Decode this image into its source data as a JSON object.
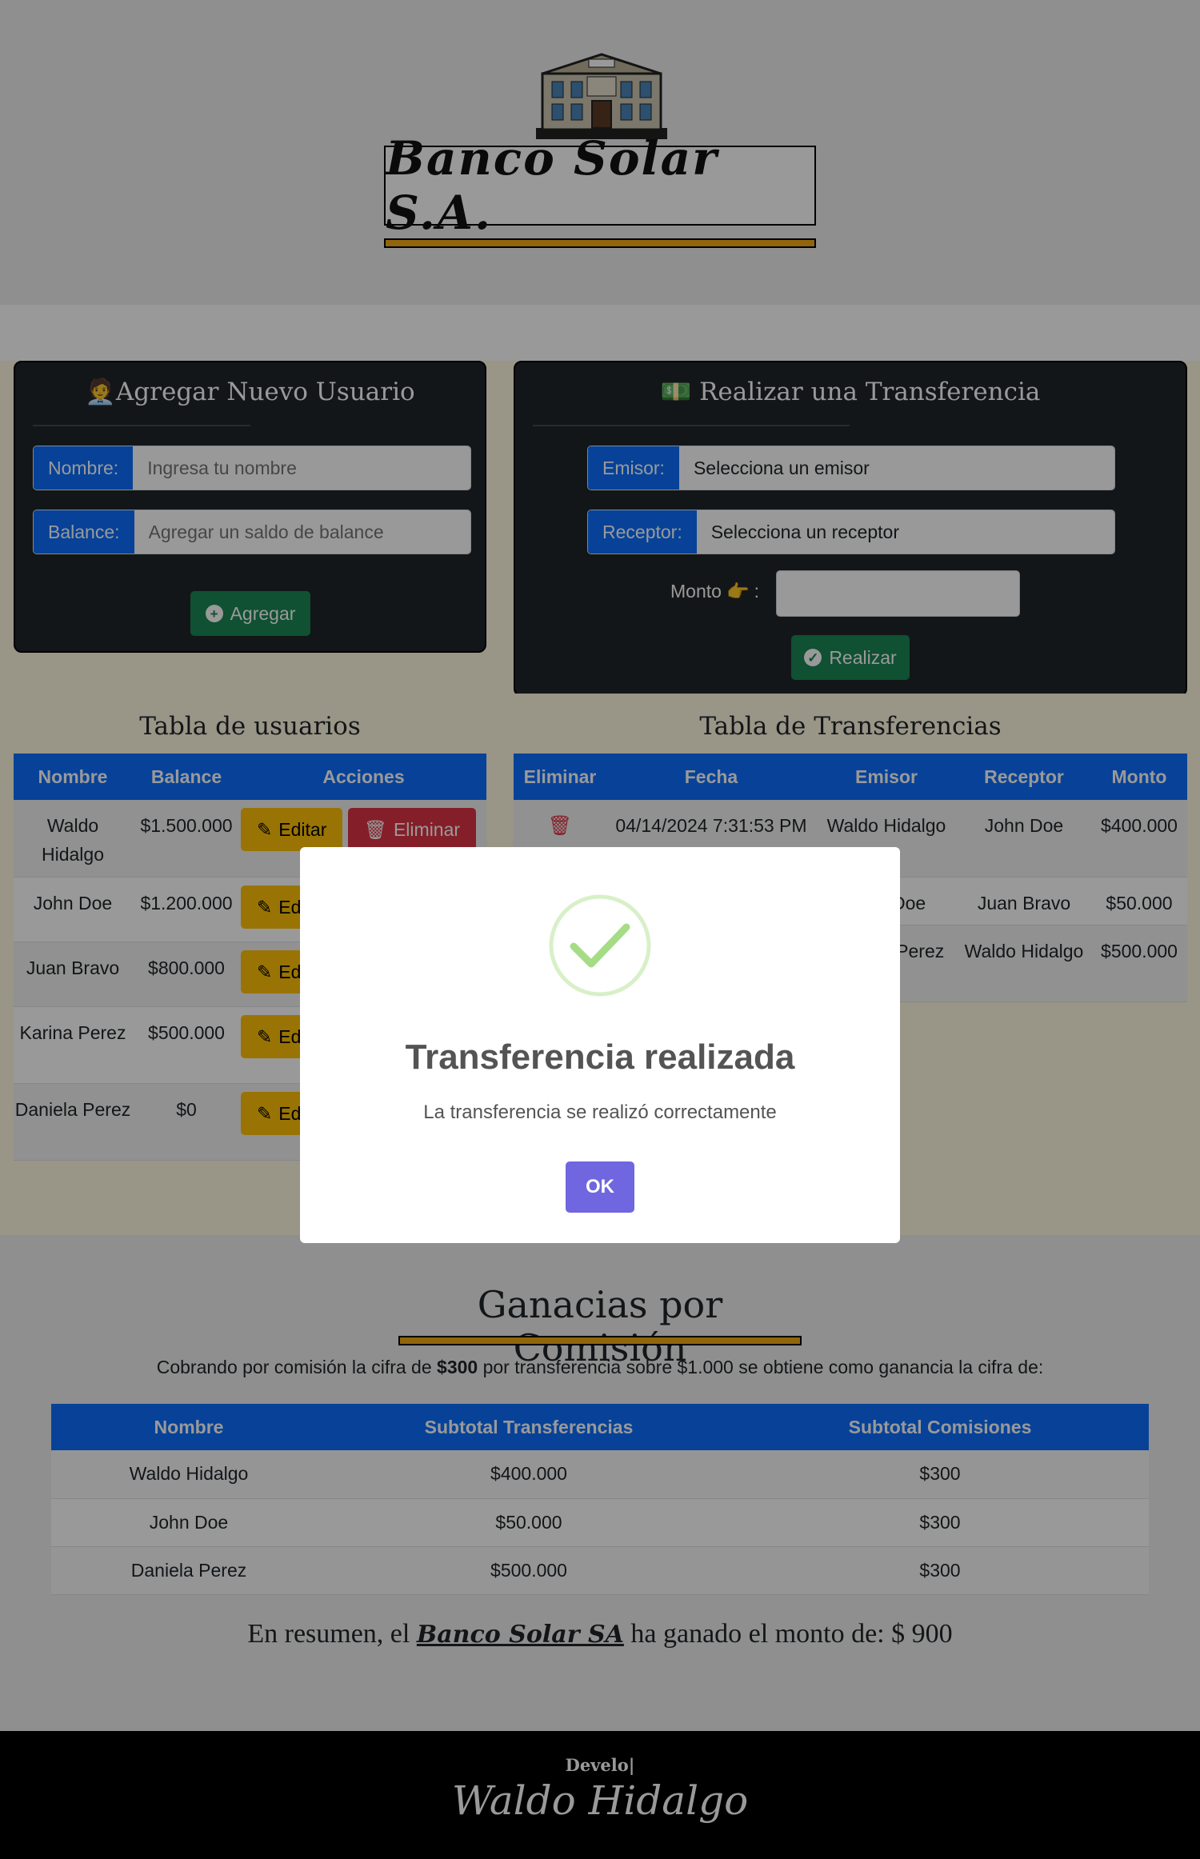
{
  "header": {
    "logo_text": "Banco Solar S.A."
  },
  "user_form": {
    "title": "Agregar Nuevo Usuario",
    "name_label": "Nombre:",
    "name_placeholder": "Ingresa tu nombre",
    "balance_label": "Balance:",
    "balance_placeholder": "Agregar un saldo de balance",
    "submit_label": "Agregar"
  },
  "transfer_form": {
    "title": "Realizar una Transferencia",
    "sender_label": "Emisor:",
    "sender_value": "Selecciona un emisor",
    "receiver_label": "Receptor:",
    "receiver_value": "Selecciona un receptor",
    "amount_label": "Monto",
    "submit_label": "Realizar"
  },
  "users_table": {
    "title": "Tabla de usuarios",
    "headers": [
      "Nombre",
      "Balance",
      "Acciones"
    ],
    "edit_label": "Editar",
    "delete_label": "Eliminar",
    "rows": [
      {
        "name": "Waldo Hidalgo",
        "balance": "$1.500.000"
      },
      {
        "name": "John Doe",
        "balance": "$1.200.000"
      },
      {
        "name": "Juan Bravo",
        "balance": "$800.000"
      },
      {
        "name": "Karina Perez",
        "balance": "$500.000"
      },
      {
        "name": "Daniela Perez",
        "balance": "$0"
      }
    ]
  },
  "transfers_table": {
    "title": "Tabla de Transferencias",
    "headers": [
      "Eliminar",
      "Fecha",
      "Emisor",
      "Receptor",
      "Monto"
    ],
    "rows": [
      {
        "date": "04/14/2024 7:31:53 PM",
        "sender": "Waldo Hidalgo",
        "receiver": "John Doe",
        "amount": "$400.000"
      },
      {
        "date": "",
        "sender": "John Doe",
        "receiver": "Juan Bravo",
        "amount": "$50.000"
      },
      {
        "date": "",
        "sender": "Daniela Perez",
        "receiver": "Waldo Hidalgo",
        "amount": "$500.000"
      }
    ]
  },
  "commission": {
    "title": "Ganacias por Comisión",
    "desc_prefix": "Cobrando por comisión la cifra de ",
    "desc_fee": "$300",
    "desc_suffix": " por transferencia sobre $1.000 se obtiene como ganancia la cifra de:",
    "headers": [
      "Nombre",
      "Subtotal Transferencias",
      "Subtotal Comisiones"
    ],
    "rows": [
      {
        "name": "Waldo Hidalgo",
        "transfers": "$400.000",
        "commission": "$300"
      },
      {
        "name": "John Doe",
        "transfers": "$50.000",
        "commission": "$300"
      },
      {
        "name": "Daniela Perez",
        "transfers": "$500.000",
        "commission": "$300"
      }
    ],
    "summary_prefix": "En resumen, el ",
    "summary_brand": "Banco Solar SA",
    "summary_suffix": " ha ganado el monto de: $ 900"
  },
  "footer": {
    "develo": "Develo|",
    "signature": "Waldo Hidalgo"
  },
  "modal": {
    "title": "Transferencia realizada",
    "text": "La transferencia se realizó correctamente",
    "ok_label": "OK"
  },
  "colors": {
    "primary": "#0d6efd",
    "success": "#198754",
    "warning": "#ffc107",
    "danger": "#dc3545",
    "accent_bar": "#f0a814",
    "modal_button": "#7066e0"
  }
}
